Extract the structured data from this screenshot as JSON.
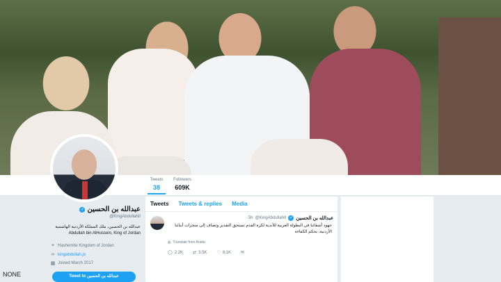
{
  "nav": {
    "stats": [
      {
        "label": "Tweets",
        "value": "38"
      },
      {
        "label": "Followers",
        "value": "609K"
      }
    ]
  },
  "profile": {
    "name": "عبدالله بن الحسين",
    "handle": "@KingAbdullahII",
    "bio_ar": "عبدالله بن الحسين، ملك المملكة الأردنية الهاشمية",
    "bio_en": "Abdullah bin AlHussein, King of Jordan",
    "location": "Hashemite Kingdom of Jordan",
    "website": "kingabdullah.jo",
    "joined": "Joined March 2017",
    "tweet_to_label": "Tweet to عبدالله بن الحسين"
  },
  "timeline": {
    "tabs": [
      "Tweets",
      "Tweets & replies",
      "Media"
    ],
    "tweet": {
      "name": "عبدالله بن الحسين",
      "handle": "@KingAbdullahII",
      "time": "· 5h",
      "text": "جهود أشقائنا في البطولة العربية للأندية لكرة القدم تستحق التقدير وتضاف إلى منجزات أبنائنا الأردنية، بحكم الكفاءة",
      "translate": "Translate from Arabic",
      "replies": "2.2K",
      "retweets": "3.5K",
      "likes": "8.1K"
    }
  },
  "watermark": "NONE"
}
